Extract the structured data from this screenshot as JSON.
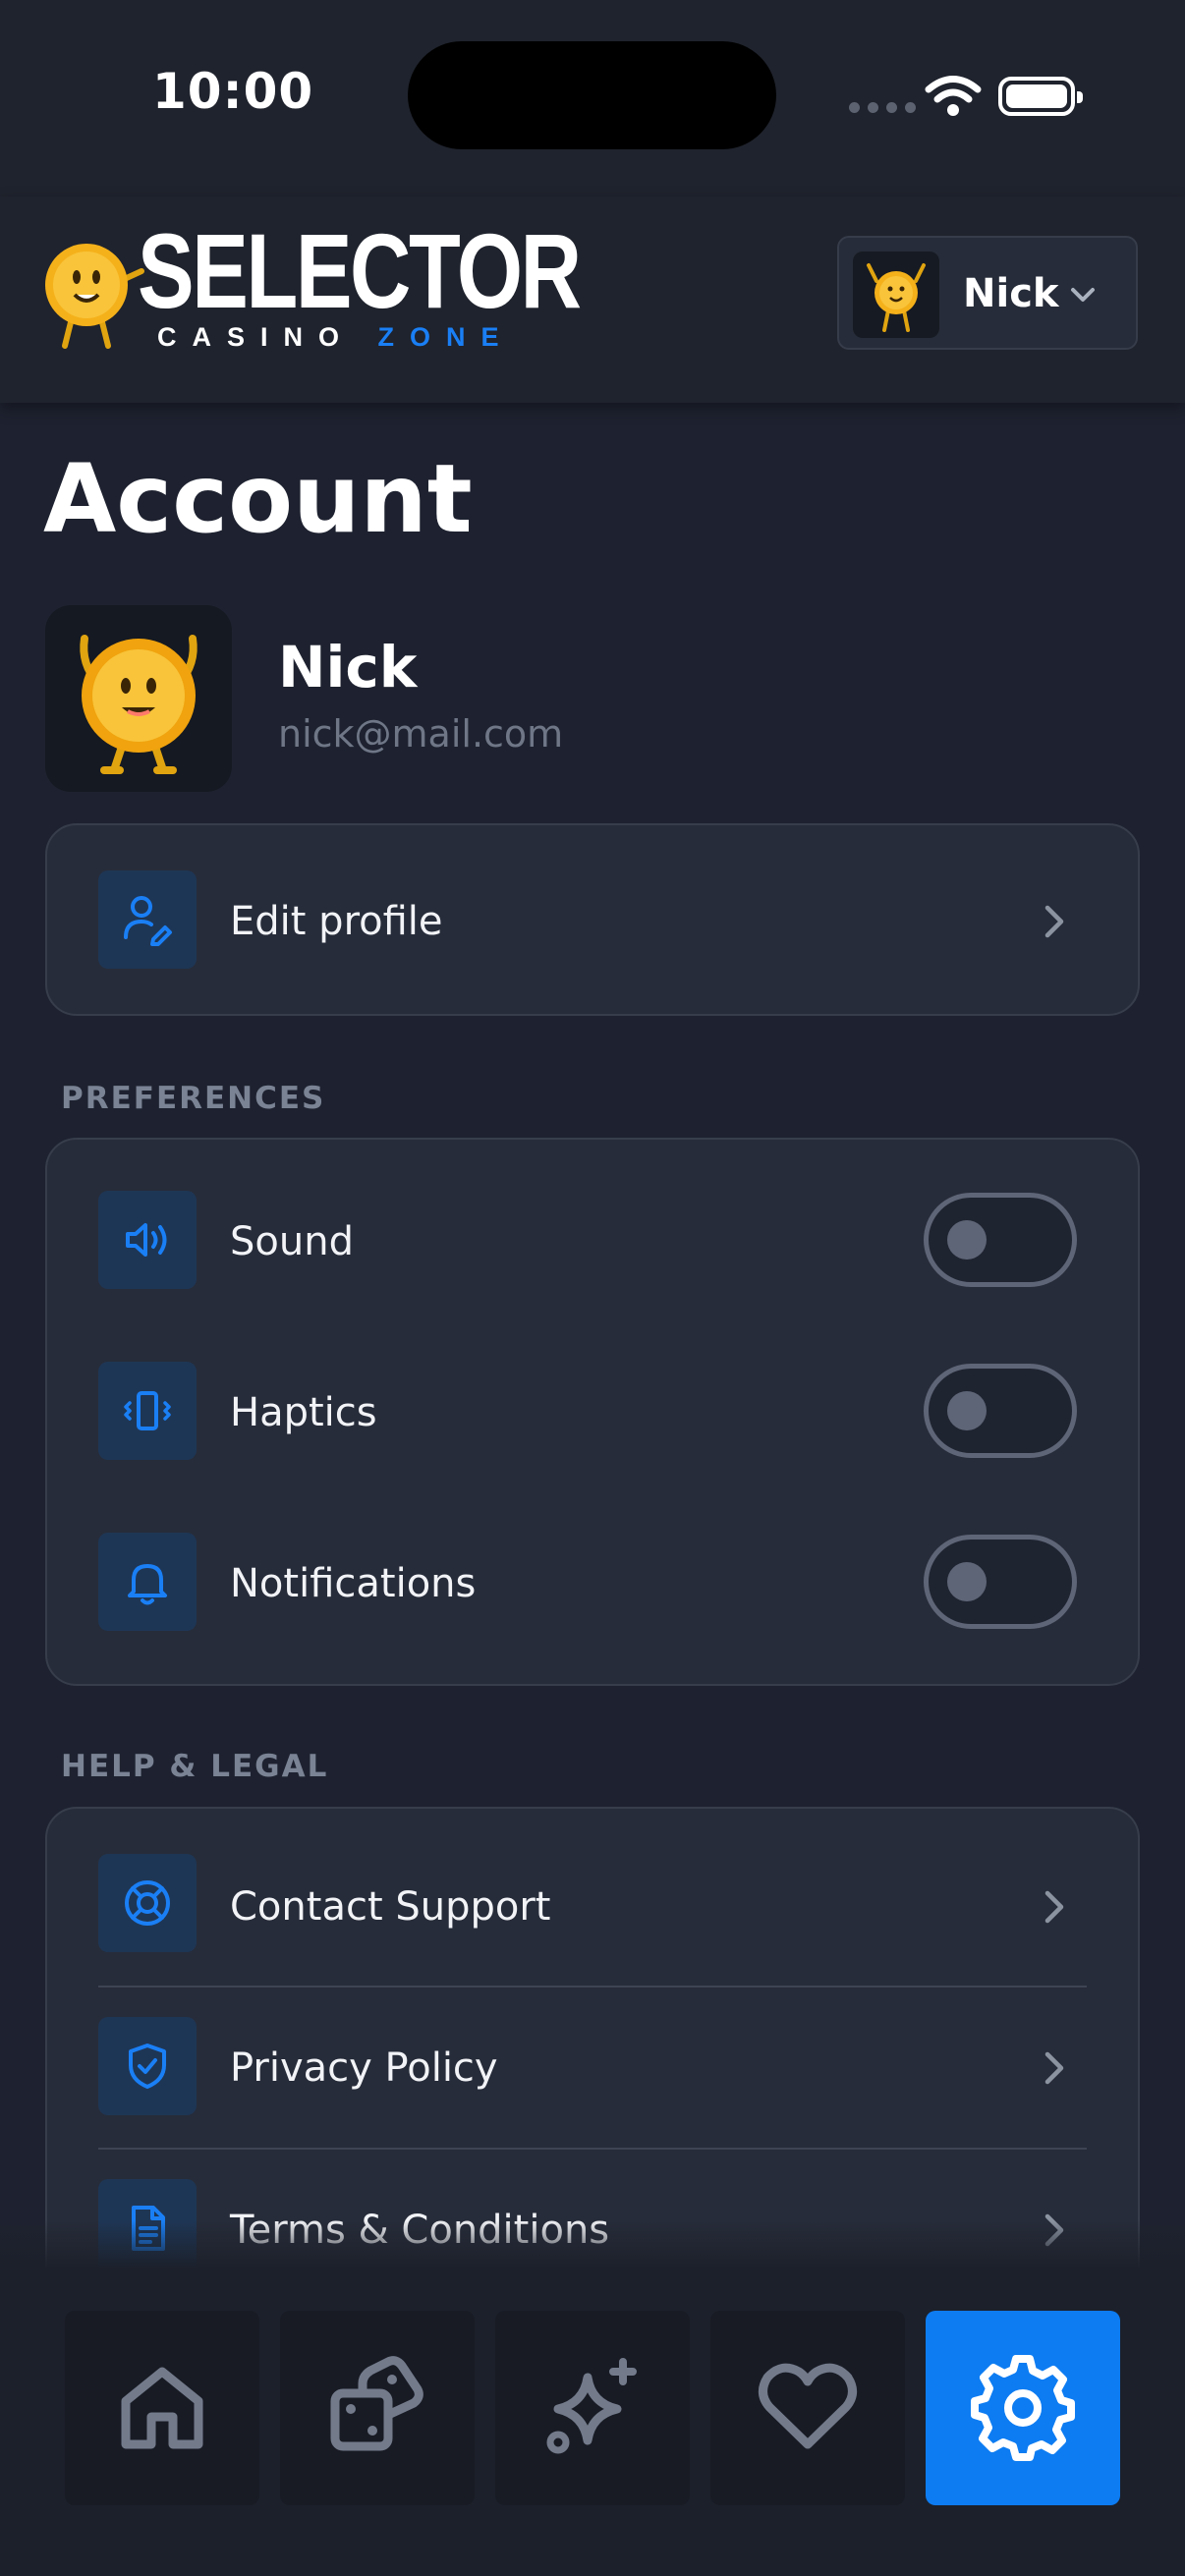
{
  "status_bar": {
    "time": "10:00"
  },
  "header": {
    "logo_title": "SELECTOR",
    "logo_sub_main": "CASINO",
    "logo_sub_accent": "ZONE",
    "user_name": "Nick"
  },
  "page": {
    "title": "Account"
  },
  "profile": {
    "name": "Nick",
    "email": "nick@mail.com"
  },
  "edit_profile_label": "Edit profile",
  "preferences": {
    "heading": "PREFERENCES",
    "items": [
      {
        "label": "Sound",
        "icon": "speaker-icon",
        "enabled": false
      },
      {
        "label": "Haptics",
        "icon": "vibrate-icon",
        "enabled": false
      },
      {
        "label": "Notifications",
        "icon": "bell-icon",
        "enabled": false
      }
    ]
  },
  "help_legal": {
    "heading": "HELP & LEGAL",
    "items": [
      {
        "label": "Contact Support",
        "icon": "lifebuoy-icon"
      },
      {
        "label": "Privacy Policy",
        "icon": "shield-check-icon"
      },
      {
        "label": "Terms & Conditions",
        "icon": "document-icon"
      }
    ]
  },
  "bottom_nav": {
    "items": [
      {
        "icon": "home-icon",
        "active": false
      },
      {
        "icon": "dice-icon",
        "active": false
      },
      {
        "icon": "sparkle-icon",
        "active": false
      },
      {
        "icon": "heart-icon",
        "active": false
      },
      {
        "icon": "gear-icon",
        "active": true
      }
    ]
  },
  "colors": {
    "background": "#1e2230",
    "card": "#272c3a",
    "accent": "#0d7cf2",
    "icon_tile": "#1e3655",
    "muted_text": "#6f7787"
  }
}
